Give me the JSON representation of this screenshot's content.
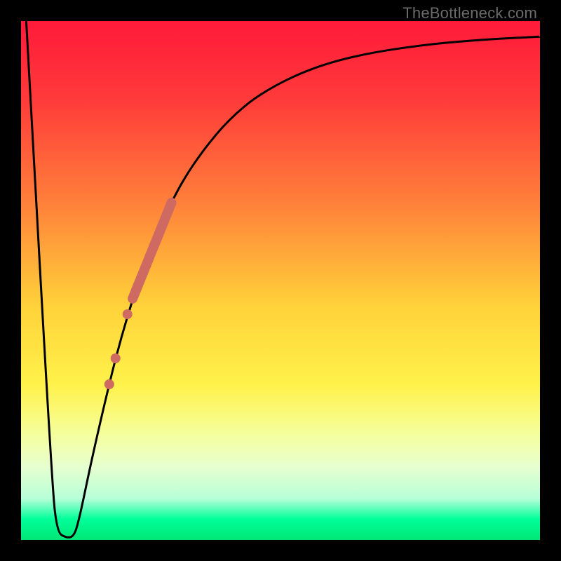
{
  "watermark": "TheBottleneck.com",
  "colors": {
    "bg": "#000000",
    "watermark": "#6b6b6b",
    "curve": "#000000",
    "highlight": "#cf6a62",
    "gradient_stops": [
      {
        "offset": 0.0,
        "color": "#ff1a3a"
      },
      {
        "offset": 0.15,
        "color": "#ff3a3a"
      },
      {
        "offset": 0.35,
        "color": "#ff803a"
      },
      {
        "offset": 0.55,
        "color": "#ffd23a"
      },
      {
        "offset": 0.7,
        "color": "#fff24a"
      },
      {
        "offset": 0.8,
        "color": "#f5ffa0"
      },
      {
        "offset": 0.86,
        "color": "#e6ffd0"
      },
      {
        "offset": 0.92,
        "color": "#b8ffd8"
      },
      {
        "offset": 0.96,
        "color": "#00ff99"
      },
      {
        "offset": 1.0,
        "color": "#00e676"
      }
    ]
  },
  "chart_data": {
    "type": "line",
    "title": "",
    "xlabel": "",
    "ylabel": "",
    "xlim": [
      0,
      100
    ],
    "ylim": [
      0,
      100
    ],
    "curve_points": [
      {
        "x": 1.0,
        "y": 100.0
      },
      {
        "x": 6.0,
        "y": 10.0
      },
      {
        "x": 7.0,
        "y": 1.5
      },
      {
        "x": 8.5,
        "y": 0.5
      },
      {
        "x": 10.0,
        "y": 0.5
      },
      {
        "x": 11.0,
        "y": 3.0
      },
      {
        "x": 13.5,
        "y": 15.0
      },
      {
        "x": 16.5,
        "y": 28.0
      },
      {
        "x": 19.0,
        "y": 38.0
      },
      {
        "x": 22.0,
        "y": 48.0
      },
      {
        "x": 25.0,
        "y": 56.0
      },
      {
        "x": 28.0,
        "y": 63.0
      },
      {
        "x": 31.0,
        "y": 69.0
      },
      {
        "x": 35.0,
        "y": 75.0
      },
      {
        "x": 40.0,
        "y": 81.0
      },
      {
        "x": 46.0,
        "y": 86.0
      },
      {
        "x": 55.0,
        "y": 90.6
      },
      {
        "x": 65.0,
        "y": 93.5
      },
      {
        "x": 78.0,
        "y": 95.5
      },
      {
        "x": 90.0,
        "y": 96.5
      },
      {
        "x": 100.0,
        "y": 97.0
      }
    ],
    "highlight_segment": {
      "x_start": 21.5,
      "y_start": 46.5,
      "x_end": 29.0,
      "y_end": 65.0
    },
    "highlight_dots": [
      {
        "x": 17.0,
        "y": 30.0
      },
      {
        "x": 18.2,
        "y": 35.0
      },
      {
        "x": 20.5,
        "y": 43.5
      }
    ]
  }
}
